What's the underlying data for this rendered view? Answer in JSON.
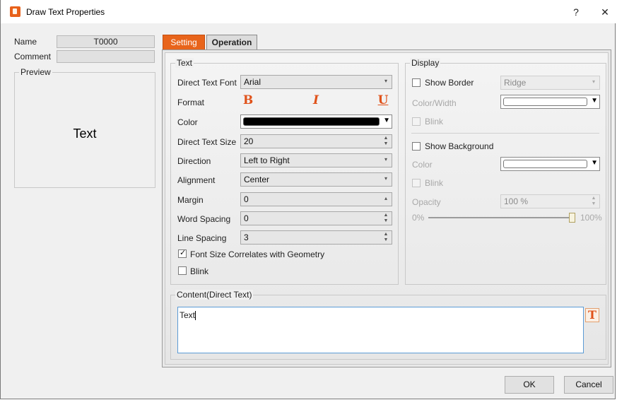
{
  "window": {
    "title": "Draw Text Properties",
    "help": "?",
    "close": "✕"
  },
  "left": {
    "name_label": "Name",
    "name_value": "T0000",
    "comment_label": "Comment",
    "comment_value": "",
    "preview_label": "Preview",
    "preview_text": "Text"
  },
  "tabs": [
    {
      "label": "Setting",
      "active": true
    },
    {
      "label": "Operation",
      "active": false
    }
  ],
  "text_group": {
    "title": "Text",
    "font_label": "Direct Text Font",
    "font_value": "Arial",
    "format_label": "Format",
    "bold": "B",
    "italic": "I",
    "underline": "U",
    "color_label": "Color",
    "color_value": "#000000",
    "size_label": "Direct Text Size",
    "size_value": "20",
    "direction_label": "Direction",
    "direction_value": "Left to Right",
    "alignment_label": "Alignment",
    "alignment_value": "Center",
    "margin_label": "Margin",
    "margin_value": "0",
    "word_spacing_label": "Word Spacing",
    "word_spacing_value": "0",
    "line_spacing_label": "Line Spacing",
    "line_spacing_value": "3",
    "correlate_label": "Font Size Correlates with Geometry",
    "correlate_checked": true,
    "blink_label": "Blink",
    "blink_checked": false
  },
  "display_group": {
    "title": "Display",
    "show_border_label": "Show Border",
    "show_border_checked": false,
    "border_style_value": "Ridge",
    "color_width_label": "Color/Width",
    "blink1_label": "Blink",
    "show_background_label": "Show Background",
    "show_background_checked": false,
    "color_label": "Color",
    "blink2_label": "Blink",
    "opacity_label": "Opacity",
    "opacity_value": "100 %",
    "slider_min": "0%",
    "slider_max": "100%",
    "slider_level": 1.0
  },
  "content_group": {
    "title": "Content(Direct Text)",
    "text": "Text"
  },
  "buttons": {
    "ok": "OK",
    "cancel": "Cancel"
  },
  "colors": {
    "accent": "#e8641b",
    "focus": "#5b9bd5"
  }
}
